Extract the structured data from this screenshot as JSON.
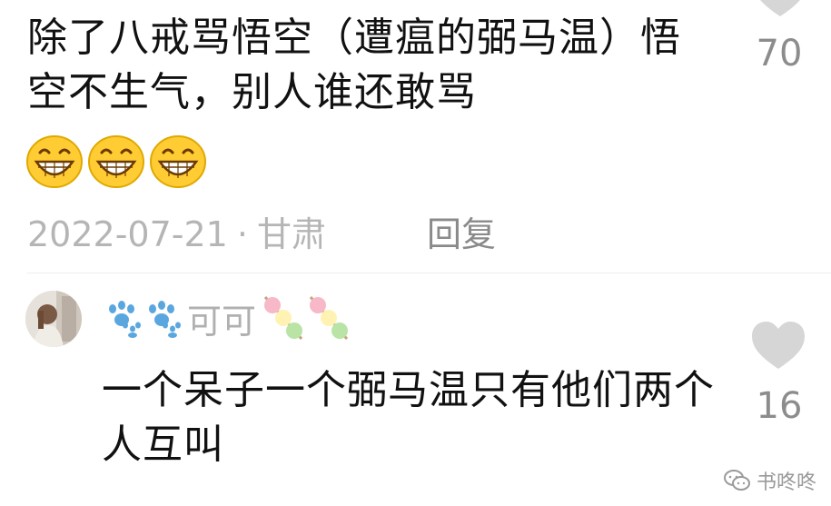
{
  "comment1": {
    "text": "除了八戒骂悟空（遭瘟的弼马温）悟空不生气，别人谁还敢骂",
    "emoji_icon": "grinning-face-icon",
    "emoji_count": 3,
    "date": "2022-07-21",
    "separator": "·",
    "location": "甘肃",
    "reply_label": "回复",
    "like_count": "70",
    "like_icon": "heart-icon"
  },
  "comment2": {
    "username": "可可",
    "username_prefix_icon": "paw-print-icon",
    "username_suffix_icon": "dango-icon",
    "text": "一个呆子一个弼马温只有他们两个人互叫",
    "like_count": "16",
    "like_icon": "heart-icon"
  },
  "watermark": {
    "text": "书咚咚",
    "icon": "wechat-icon"
  },
  "colors": {
    "text": "#111111",
    "meta": "#b5b5b5",
    "reply": "#8a8a8a",
    "heart": "#d6d6d6",
    "count": "#8c8c8c",
    "emoji_yellow": "#ffcc33"
  }
}
